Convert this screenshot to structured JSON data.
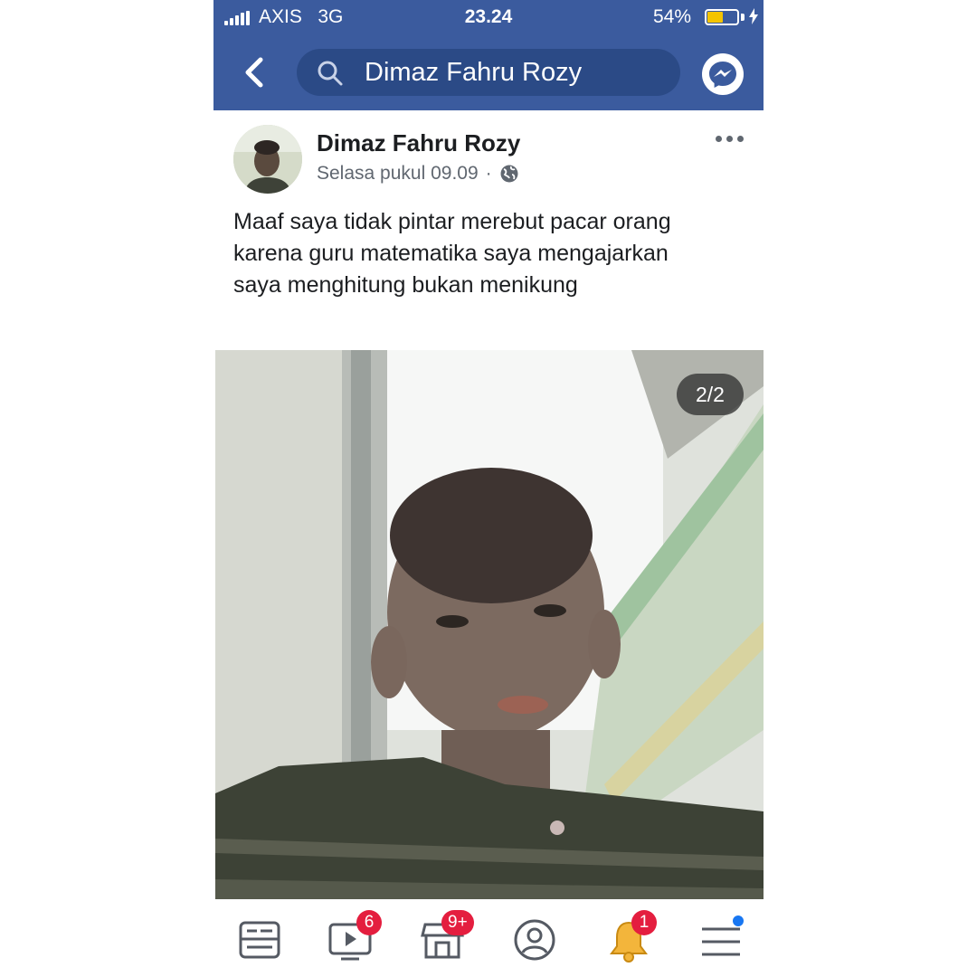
{
  "status_bar": {
    "carrier": "AXIS",
    "network": "3G",
    "time": "23.24",
    "battery_percent": "54%",
    "battery_level": 0.54
  },
  "header": {
    "search_query": "Dimaz Fahru Rozy",
    "icons": [
      "back-icon",
      "search-icon",
      "messenger-icon"
    ]
  },
  "post": {
    "author": "Dimaz Fahru Rozy",
    "timestamp": "Selasa pukul 09.09",
    "separator": "·",
    "privacy_icon": "globe-icon",
    "text_lines": [
      "Maaf saya tidak pintar merebut pacar orang",
      "karena guru matematika saya mengajarkan",
      "saya menghitung bukan menikung"
    ],
    "photo_counter": "2/2"
  },
  "bottom_nav": {
    "items": [
      {
        "icon": "news-feed-icon"
      },
      {
        "icon": "watch-icon",
        "badge": "6"
      },
      {
        "icon": "marketplace-icon",
        "badge": "9+"
      },
      {
        "icon": "profile-icon"
      },
      {
        "icon": "notifications-icon",
        "badge": "1"
      },
      {
        "icon": "menu-icon"
      }
    ]
  },
  "colors": {
    "header_blue": "#3b5b9e",
    "search_bg": "#2b4a86",
    "badge_red": "#e41e3f",
    "dot_blue": "#1877f2",
    "battery_yellow": "#f4c400"
  }
}
